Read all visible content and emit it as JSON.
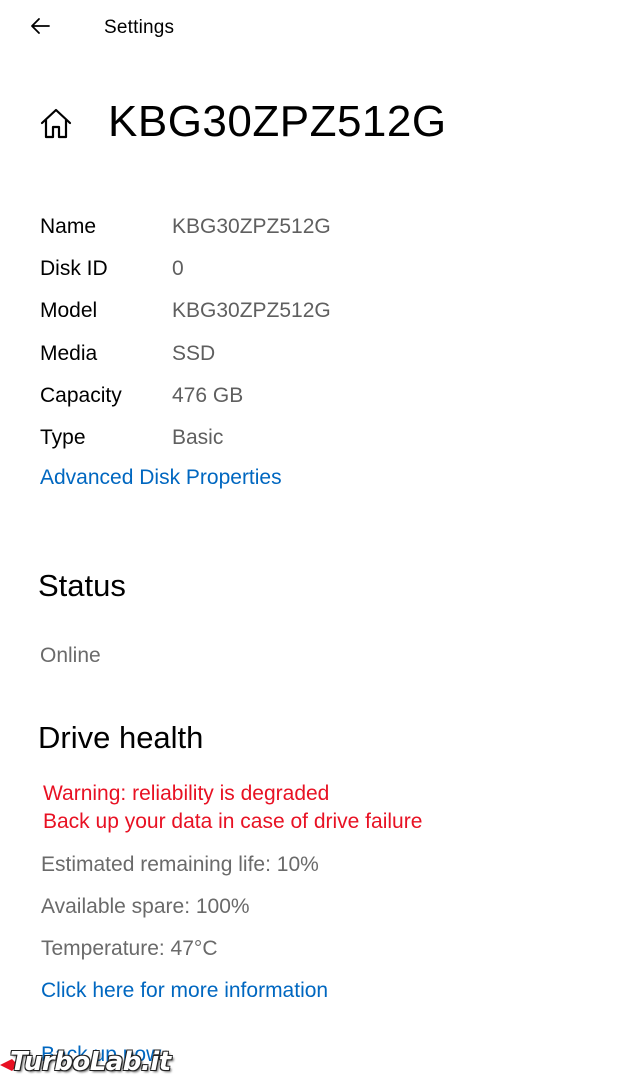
{
  "titlebar": {
    "title": "Settings",
    "back_icon": "back-arrow-icon"
  },
  "header": {
    "home_icon": "home-icon",
    "title": "KBG30ZPZ512G"
  },
  "properties": [
    {
      "label": "Name",
      "value": "KBG30ZPZ512G"
    },
    {
      "label": "Disk ID",
      "value": "0"
    },
    {
      "label": "Model",
      "value": "KBG30ZPZ512G"
    },
    {
      "label": "Media",
      "value": "SSD"
    },
    {
      "label": "Capacity",
      "value": "476 GB"
    },
    {
      "label": "Type",
      "value": "Basic"
    }
  ],
  "advanced_link": "Advanced Disk Properties",
  "status": {
    "title": "Status",
    "value": "Online"
  },
  "drive_health": {
    "title": "Drive health",
    "warning_line1": "Warning: reliability is degraded",
    "warning_line2": "Back up your data in case of drive failure",
    "remaining_life": "Estimated remaining life: 10%",
    "available_spare": "Available spare: 100%",
    "temperature": "Temperature: 47°C",
    "more_info_link": "Click here for more information",
    "backup_link": "Back up now"
  },
  "watermark": {
    "text": "TurboLab.it"
  },
  "colors": {
    "link": "#0067c0",
    "warning": "#e81123",
    "secondary_text": "#5f5f5f"
  }
}
